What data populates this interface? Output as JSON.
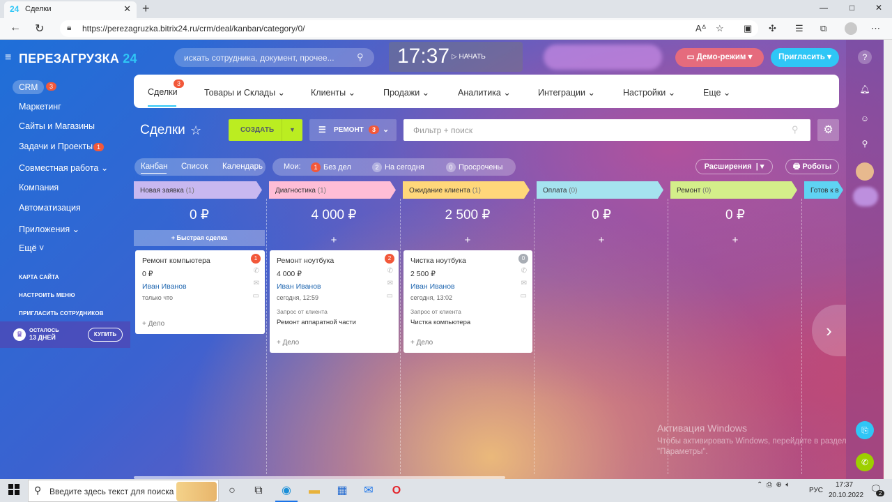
{
  "browser": {
    "tab_favicon": "24",
    "tab_title": "Сделки",
    "tab_close": "✕",
    "new_tab": "+",
    "min": "—",
    "max": "□",
    "close": "✕",
    "back": "←",
    "reload": "↻",
    "url": "https://perezagruzka.bitrix24.ru/crm/deal/kanban/category/0/"
  },
  "logo": {
    "name": "ПЕРЕЗАГРУЗКА",
    "num": "24"
  },
  "sidebar": {
    "crm": "CRM",
    "crm_badge": "3",
    "items": [
      {
        "label": "Маркетинг"
      },
      {
        "label": "Сайты и Магазины"
      },
      {
        "label": "Задачи и Проекты",
        "badge": "1"
      },
      {
        "label": "Совместная работа ⌄"
      },
      {
        "label": "Компания"
      },
      {
        "label": "Автоматизация"
      },
      {
        "label": "Приложения ⌄"
      },
      {
        "label": "Ещё ˅"
      }
    ],
    "links": [
      "КАРТА САЙТА",
      "НАСТРОИТЬ МЕНЮ",
      "ПРИГЛАСИТЬ СОТРУДНИКОВ"
    ],
    "trial_line1": "ОСТАЛОСЬ",
    "trial_line2": "13 ДНЕЙ",
    "buy": "КУПИТЬ"
  },
  "header": {
    "search_placeholder": "искать сотрудника, документ, прочее...",
    "time": "17:37",
    "start": "НАЧАТЬ",
    "demo": "Демо-режим",
    "invite": "Пригласить"
  },
  "toptabs": {
    "items": [
      {
        "label": "Сделки",
        "badge": "3"
      },
      {
        "label": "Товары и Склады ⌄"
      },
      {
        "label": "Клиенты ⌄"
      },
      {
        "label": "Продажи ⌄"
      },
      {
        "label": "Аналитика ⌄"
      },
      {
        "label": "Интеграции ⌄"
      },
      {
        "label": "Настройки ⌄"
      },
      {
        "label": "Еще ⌄"
      }
    ]
  },
  "toolbar": {
    "title": "Сделки",
    "star": "☆",
    "create": "СОЗДАТЬ",
    "remont": "РЕМОНТ",
    "remont_badge": "3",
    "filter_placeholder": "Фильтр + поиск"
  },
  "views": {
    "kanban": "Канбан",
    "list": "Список",
    "calendar": "Календарь"
  },
  "counters": {
    "label": "Мои:",
    "items": [
      {
        "num": "1",
        "label": "Без дел",
        "color": "#f2583a"
      },
      {
        "num": "2",
        "label": "На сегодня",
        "color": "rgba(255,255,255,.35)"
      },
      {
        "num": "0",
        "label": "Просрочены",
        "color": "rgba(255,255,255,.35)"
      }
    ]
  },
  "buttons": {
    "extensions": "Расширения",
    "robots": "Роботы"
  },
  "columns": [
    {
      "name": "Новая заявка",
      "count": "(1)",
      "sum": "0 ₽",
      "color": "#c8b8f0"
    },
    {
      "name": "Диагностика",
      "count": "(1)",
      "sum": "4 000 ₽",
      "color": "#ffbdd6"
    },
    {
      "name": "Ожидание клиента",
      "count": "(1)",
      "sum": "2 500 ₽",
      "color": "#ffd77a"
    },
    {
      "name": "Оплата",
      "count": "(0)",
      "sum": "0 ₽",
      "color": "#a5e3ef"
    },
    {
      "name": "Ремонт",
      "count": "(0)",
      "sum": "0 ₽",
      "color": "#d4ee8a"
    },
    {
      "name": "Готов к в",
      "count": "",
      "sum": "",
      "color": "#5fd3f3"
    }
  ],
  "quick_deal": "+ Быстрая сделка",
  "plus": "+",
  "cards": [
    {
      "title": "Ремонт компьютера",
      "badge": "1",
      "badge_color": "#f2583a",
      "price": "0 ₽",
      "name": "Иван Иванов",
      "time": "только что",
      "source": "",
      "desc": "",
      "add": "+ Дело"
    },
    {
      "title": "Ремонт ноутбука",
      "badge": "2",
      "badge_color": "#f2583a",
      "price": "4 000 ₽",
      "name": "Иван Иванов",
      "time": "сегодня, 12:59",
      "source": "Запрос от клиента",
      "desc": "Ремонт аппаратной части",
      "add": "+ Дело"
    },
    {
      "title": "Чистка ноутбука",
      "badge": "0",
      "badge_color": "#a8adb4",
      "price": "2 500 ₽",
      "name": "Иван Иванов",
      "time": "сегодня, 13:02",
      "source": "Запрос от клиента",
      "desc": "Чистка компьютера",
      "add": "+ Дело"
    }
  ],
  "watermark": {
    "title": "Активация Windows",
    "text": "Чтобы активировать Windows, перейдите в раздел \"Параметры\"."
  },
  "taskbar": {
    "search": "Введите здесь текст для поиска",
    "lang": "РУС",
    "time": "17:37",
    "date": "20.10.2022",
    "notif": "2"
  }
}
